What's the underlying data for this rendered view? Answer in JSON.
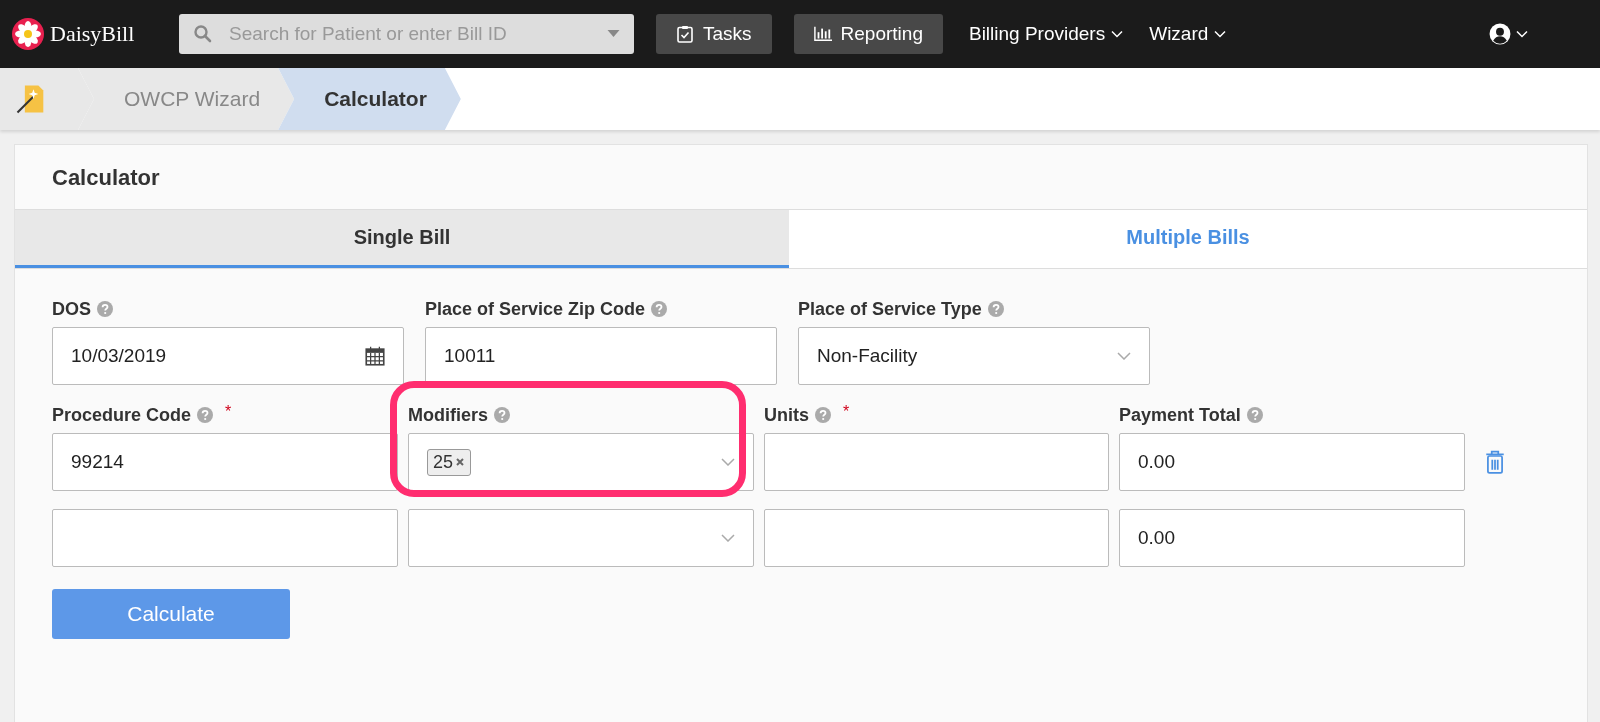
{
  "nav": {
    "logo": "DaisyBill",
    "search": {
      "placeholder": "Search for Patient or enter Bill ID"
    },
    "buttons": [
      {
        "label": "Tasks",
        "kind": "tasks"
      },
      {
        "label": "Reporting",
        "kind": "reporting"
      }
    ],
    "menus": [
      {
        "label": "Billing Providers"
      },
      {
        "label": "Wizard"
      }
    ]
  },
  "breadcrumb": [
    {
      "label": "OWCP Wizard",
      "selected": false
    },
    {
      "label": "Calculator",
      "selected": true
    }
  ],
  "card": {
    "title": "Calculator"
  },
  "tabs": [
    {
      "label": "Single Bill",
      "selected": true
    },
    {
      "label": "Multiple Bills",
      "selected": false
    }
  ],
  "fields_top": [
    {
      "label": "DOS",
      "kind": "date",
      "value": "10/03/2019"
    },
    {
      "label": "Place of Service Zip Code",
      "kind": "text",
      "value": "10011"
    },
    {
      "label": "Place of Service Type",
      "kind": "select",
      "value": "Non-Facility"
    }
  ],
  "line_headers": [
    {
      "label": "Procedure Code",
      "required_mark": "*",
      "highlighted": false
    },
    {
      "label": "Modifiers",
      "highlighted": true
    },
    {
      "label": "Units",
      "required_mark": "*",
      "highlighted": false
    },
    {
      "label": "Payment Total",
      "highlighted": false
    }
  ],
  "lines": [
    {
      "procedure_code": "99214",
      "modifiers": [
        "25"
      ],
      "payment_total": "0.00",
      "deletable": true
    },
    {
      "payment_total": "0.00",
      "deletable": false
    }
  ],
  "calculate_button": "Calculate"
}
